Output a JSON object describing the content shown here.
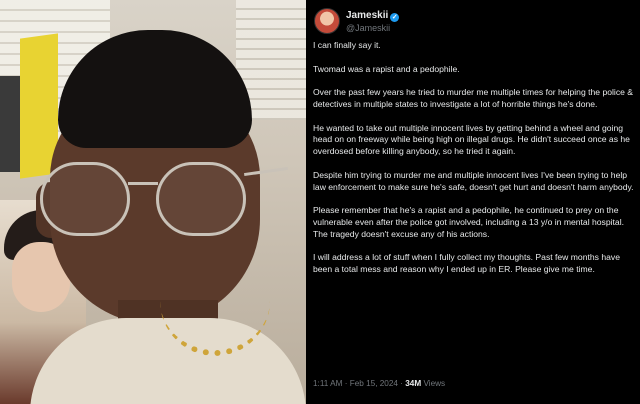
{
  "post": {
    "author": {
      "display_name": "Jameskii",
      "handle": "@Jameskii",
      "verified_icon": "verified-badge-icon"
    },
    "paragraphs": [
      "I can finally say it.",
      "Twomad was a rapist and a pedophile.",
      "Over the past few years he tried to murder me multiple times for helping the police & detectives in multiple states to investigate a lot of horrible things he's done.",
      "He wanted to take out multiple innocent lives by getting behind a wheel and going head on on freeway while being high on illegal drugs. He didn't succeed once as he overdosed before killing anybody, so he tried it again.",
      "Despite him trying to murder me and multiple innocent lives I've been trying to help law enforcement to make sure he's safe, doesn't get hurt and doesn't harm anybody.",
      "Please remember that he's a rapist and a pedophile, he continued to prey on the vulnerable even after the police got involved, including a 13 y/o in mental hospital. The tragedy doesn't excuse any of his actions.",
      "I will address a lot of stuff when I fully collect my thoughts. Past few months have been a total mess and  reason why I ended up in ER. Please give me time."
    ],
    "timestamp": "1:11 AM · Feb 15, 2024 · ",
    "views_count": "34M",
    "views_label": " Views"
  },
  "colors": {
    "background": "#000000",
    "text": "#e7e9ea",
    "secondary_text": "#71767b",
    "verified": "#1d9bf0"
  }
}
